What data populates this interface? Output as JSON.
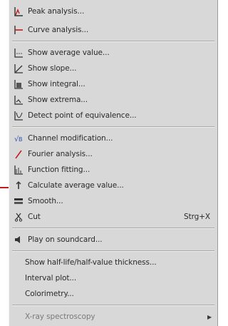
{
  "menu": {
    "peak_analysis": "Peak analysis...",
    "curve_analysis": "Curve analysis...",
    "show_average_value": "Show average value...",
    "show_slope": "Show slope...",
    "show_integral": "Show integral...",
    "show_extrema": "Show extrema...",
    "detect_point_of_equivalence": "Detect point of equivalence...",
    "channel_modification": "Channel modification...",
    "fourier_analysis": "Fourier analysis...",
    "function_fitting": "Function fitting...",
    "calculate_average_value": "Calculate average value...",
    "smooth": "Smooth...",
    "cut": "Cut",
    "cut_shortcut": "Strg+X",
    "play_on_soundcard": "Play on soundcard...",
    "show_half_life": "Show half-life/half-value thickness...",
    "interval_plot": "Interval plot...",
    "colorimetry": "Colorimetry...",
    "xray_spectroscopy": "X-ray spectroscopy"
  },
  "colors": {
    "menu_background": "#d8d8d8",
    "icon_red": "#c21a1a",
    "icon_blue": "#2a4fb0",
    "text": "#2a2a2a"
  }
}
